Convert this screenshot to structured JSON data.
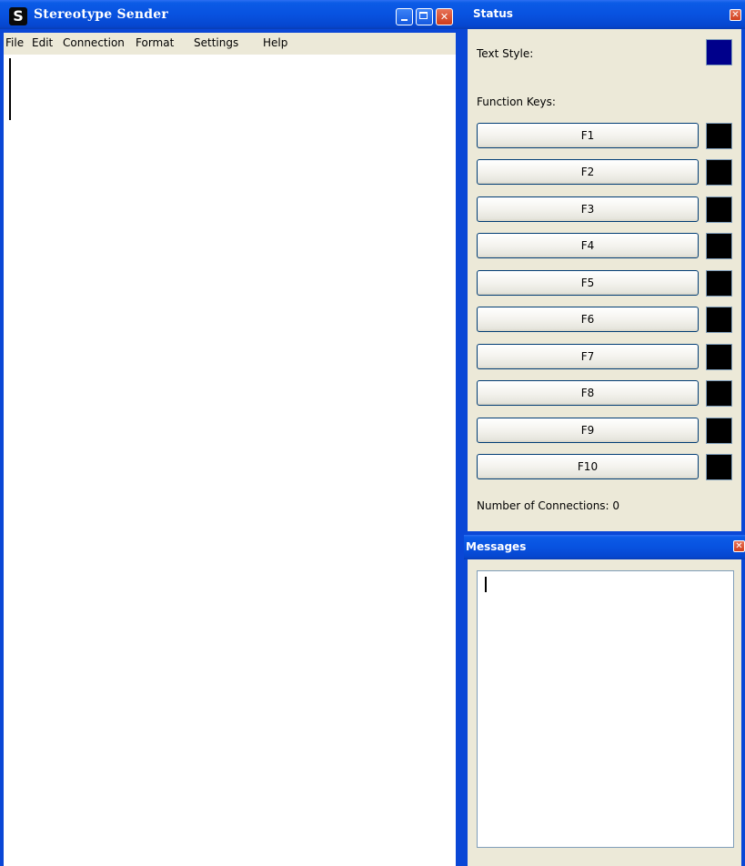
{
  "main_window": {
    "app_icon_letter": "S",
    "title": "Stereotype Sender",
    "close_glyph": "✕"
  },
  "menu": [
    {
      "label": "File"
    },
    {
      "label": "Edit"
    },
    {
      "label": "Connection"
    },
    {
      "label": "Format"
    },
    {
      "label": "Settings"
    },
    {
      "label": "Help"
    }
  ],
  "status_panel": {
    "title": "Status",
    "close_glyph": "✕",
    "text_style_label": "Text Style:",
    "text_style_color": "#00008b",
    "function_keys_label": "Function Keys:",
    "function_keys": [
      {
        "label": "F1",
        "color": "#000000"
      },
      {
        "label": "F2",
        "color": "#000000"
      },
      {
        "label": "F3",
        "color": "#000000"
      },
      {
        "label": "F4",
        "color": "#000000"
      },
      {
        "label": "F5",
        "color": "#000000"
      },
      {
        "label": "F6",
        "color": "#000000"
      },
      {
        "label": "F7",
        "color": "#000000"
      },
      {
        "label": "F8",
        "color": "#000000"
      },
      {
        "label": "F9",
        "color": "#000000"
      },
      {
        "label": "F10",
        "color": "#000000"
      }
    ],
    "connections_text": "Number of Connections: 0"
  },
  "messages_panel": {
    "title": "Messages",
    "close_glyph": "✕",
    "content": ""
  }
}
